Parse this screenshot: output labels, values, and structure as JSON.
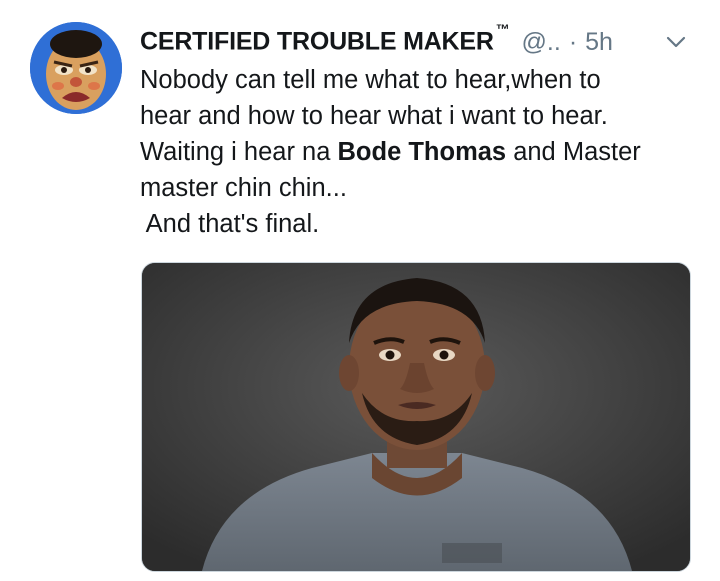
{
  "tweet": {
    "display_name": "CERTIFIED TROUBLE MAKER",
    "trademark": "™",
    "handle": "@..",
    "separator": "·",
    "time": "5h",
    "text_lines": [
      "Nobody can tell me what to hear,when to",
      "hear and how to hear what i want to hear.",
      "Waiting i hear na ",
      "master chin chin...",
      " And that's final."
    ],
    "mention": "Bode Thomas",
    "line3_suffix": " and Master",
    "avatar_icon": "angry-face-avatar",
    "menu_icon": "chevron-down-icon",
    "media": {
      "description_icon": "man-portrait-photo"
    },
    "colors": {
      "text": "#14171a",
      "muted": "#657786",
      "border": "#ccd6dd",
      "avatar_bg": "#2f6fd6"
    }
  }
}
